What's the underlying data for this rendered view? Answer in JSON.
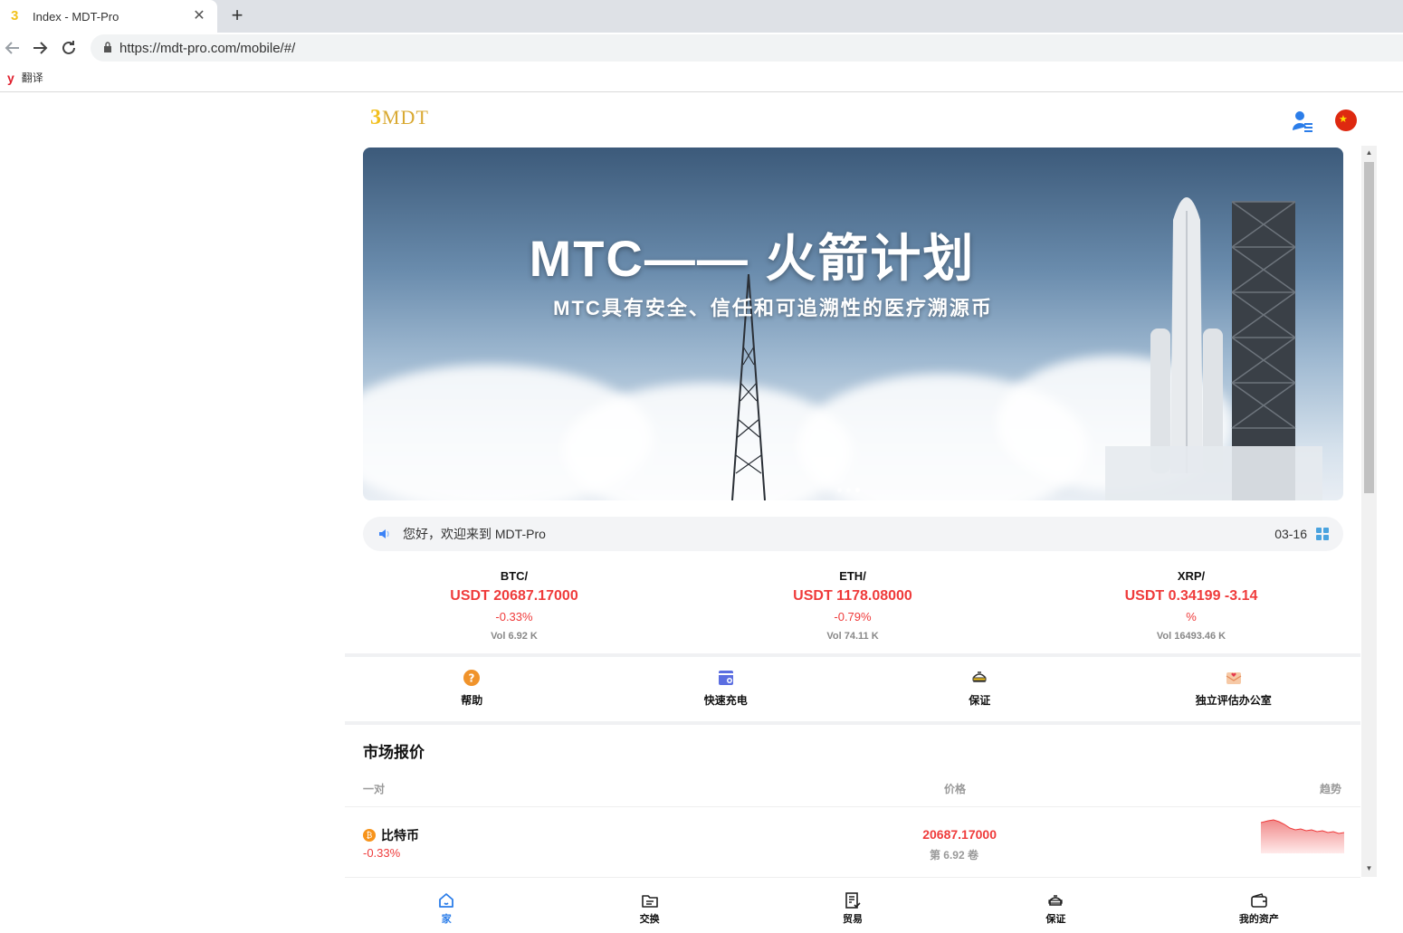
{
  "browser": {
    "tab_title": "Index - MDT-Pro",
    "tab_favicon": "3",
    "close_glyph": "✕",
    "new_tab_glyph": "+",
    "url": "https://mdt-pro.com/mobile/#/",
    "bookmark_icon": "y",
    "bookmark_label": "翻译"
  },
  "header": {
    "logo_prefix": "3",
    "logo_text": "MDT",
    "flag_glyph": "★"
  },
  "banner": {
    "title": "MTC—— 火箭计划",
    "subtitle": "MTC具有安全、信任和可追溯性的医疗溯源币",
    "slide_count": 3,
    "active_slide": 3
  },
  "notice": {
    "text": "您好，欢迎来到 MDT-Pro",
    "date": "03-16"
  },
  "tickers": [
    {
      "pair": "BTC/",
      "price": "USDT 20687.17000",
      "change": "-0.33%",
      "volume": "Vol 6.92 K"
    },
    {
      "pair": "ETH/",
      "price": "USDT 1178.08000",
      "change": "-0.79%",
      "volume": "Vol 74.11 K"
    },
    {
      "pair": "XRP/",
      "price": "USDT 0.34199 -3.14",
      "change": "%",
      "volume": "Vol 16493.46 K"
    }
  ],
  "quick_links": [
    {
      "label": "帮助",
      "icon": "help-icon"
    },
    {
      "label": "快速充电",
      "icon": "recharge-icon"
    },
    {
      "label": "保证",
      "icon": "guarantee-icon"
    },
    {
      "label": "独立评估办公室",
      "icon": "mail-icon"
    }
  ],
  "market": {
    "title": "市场报价",
    "col_pair": "一对",
    "col_price": "价格",
    "col_trend": "趋势",
    "rows": [
      {
        "coin_glyph": "₿",
        "name": "比特币",
        "change": "-0.33%",
        "price": "20687.17000",
        "volume": "第 6.92 卷"
      }
    ]
  },
  "bottom_nav": [
    {
      "label": "家",
      "icon": "home-icon",
      "active": true
    },
    {
      "label": "交换",
      "icon": "exchange-icon",
      "active": false
    },
    {
      "label": "贸易",
      "icon": "trade-icon",
      "active": false
    },
    {
      "label": "保证",
      "icon": "guarantee-icon",
      "active": false
    },
    {
      "label": "我的资产",
      "icon": "wallet-icon",
      "active": false
    }
  ],
  "colors": {
    "up_down_red": "#ef3b3b",
    "accent_blue": "#2b7de9",
    "logo_gold": "#d9a932"
  }
}
